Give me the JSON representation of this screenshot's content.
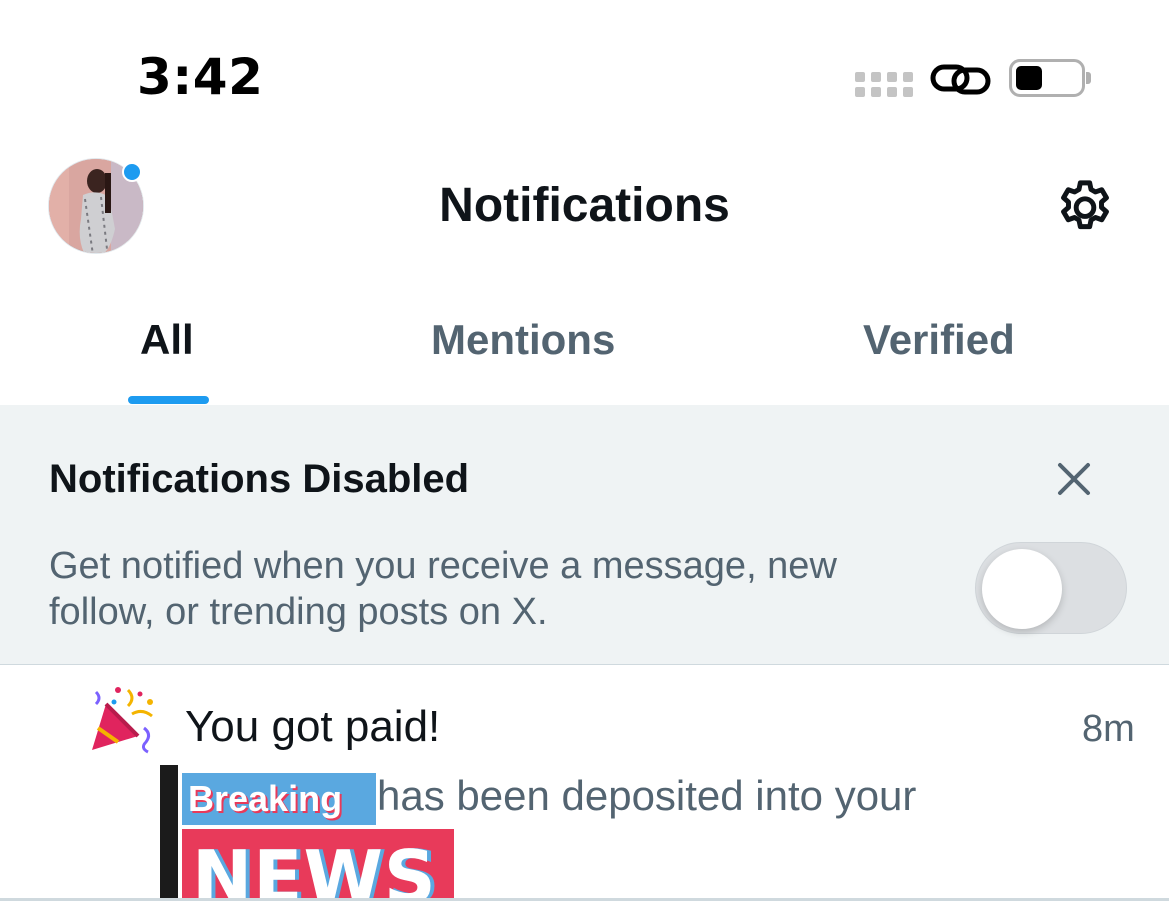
{
  "status_bar": {
    "time": "3:42",
    "icons": [
      "signal-dots-icon",
      "link-icon",
      "battery-icon"
    ],
    "battery_level": 0.35
  },
  "header": {
    "title": "Notifications",
    "avatar_has_badge": true,
    "settings_icon": "gear-icon"
  },
  "tabs": [
    {
      "label": "All",
      "active": true
    },
    {
      "label": "Mentions",
      "active": false
    },
    {
      "label": "Verified",
      "active": false
    }
  ],
  "banner": {
    "title": "Notifications Disabled",
    "text": "Get notified when you receive a message, new follow, or trending posts on X.",
    "toggle_on": false,
    "close_icon": "close-icon"
  },
  "notifications": [
    {
      "icon": "party-popper-icon",
      "title": "You got paid!",
      "time": "8m",
      "body": "has been deposited into your",
      "overlay_breaking": "Breaking",
      "overlay_news": "NEWS"
    }
  ],
  "colors": {
    "accent": "#1d9bf0",
    "text_primary": "#0f1419",
    "text_secondary": "#536471",
    "banner_bg": "#eff3f4",
    "news_red": "#e83a5a",
    "news_blue": "#5aa8e0"
  }
}
